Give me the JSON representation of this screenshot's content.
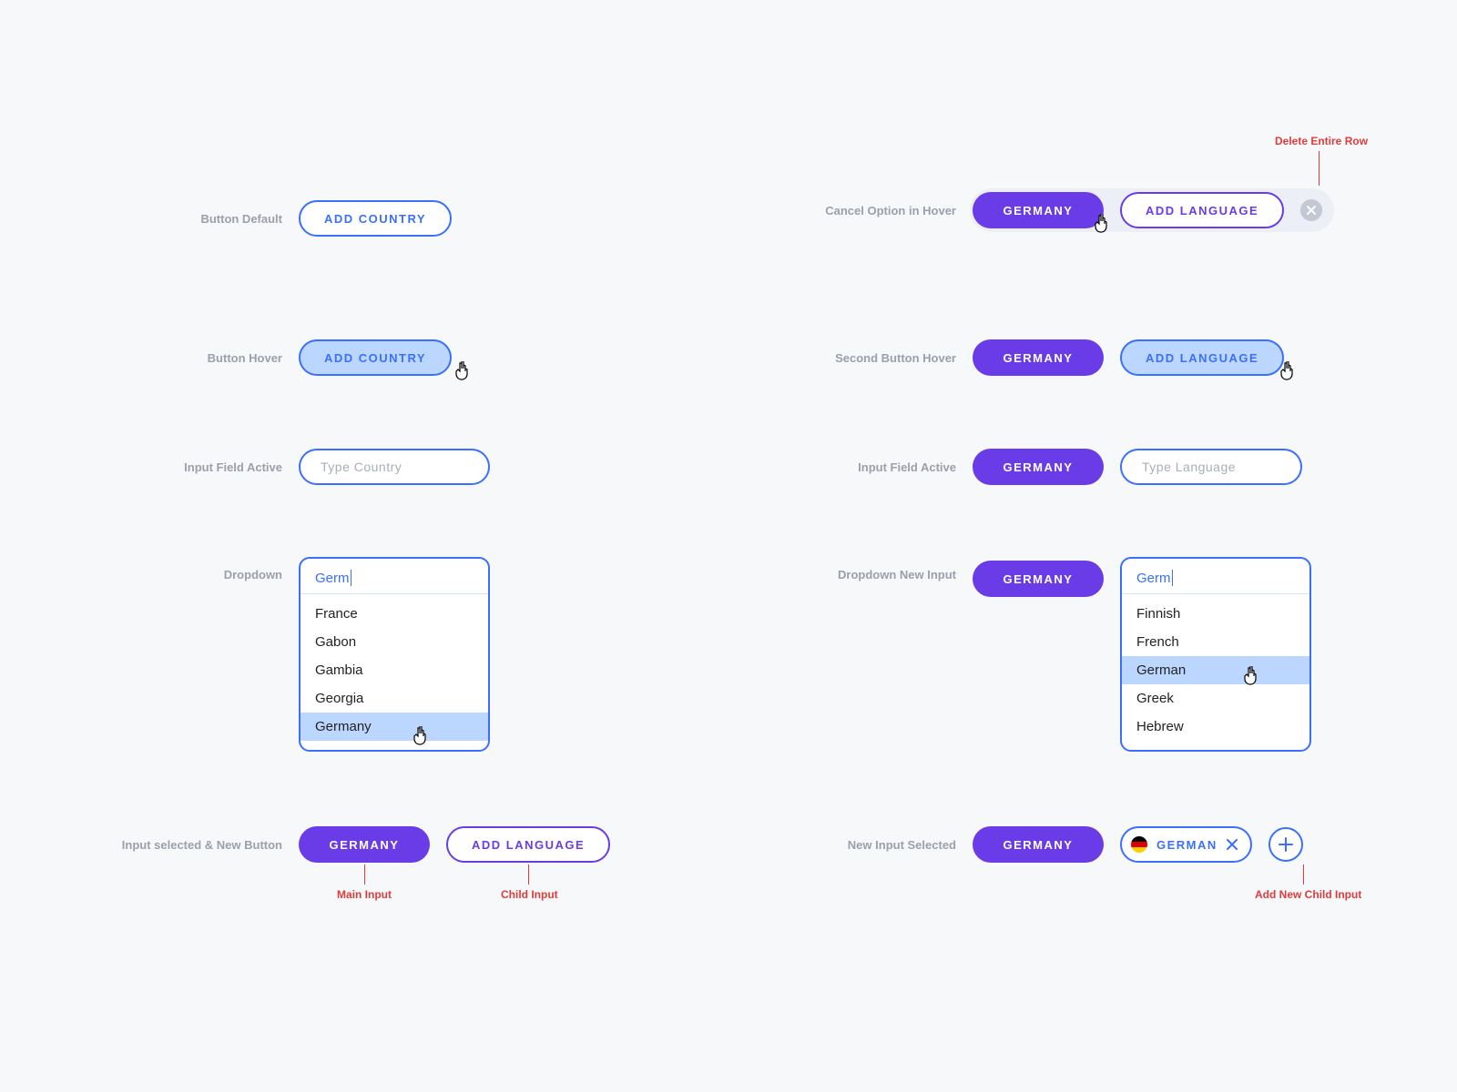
{
  "left": {
    "state1": {
      "label": "Button Default",
      "button": "ADD COUNTRY"
    },
    "state2": {
      "label": "Button Hover",
      "button": "ADD COUNTRY"
    },
    "state3": {
      "label": "Input Field Active",
      "placeholder": "Type Country"
    },
    "state4": {
      "label": "Dropdown",
      "typed": "Germ",
      "options": [
        "France",
        "Gabon",
        "Gambia",
        "Georgia",
        "Germany"
      ],
      "hovered_index": 4
    },
    "state5": {
      "label": "Input selected & New Button",
      "main": "GERMANY",
      "child_button": "ADD LANGUAGE",
      "annot_main": "Main Input",
      "annot_child": "Child Input"
    }
  },
  "right": {
    "state1": {
      "label": "Cancel Option in Hover",
      "main": "GERMANY",
      "child_button": "ADD LANGUAGE",
      "annot_delete": "Delete Entire Row"
    },
    "state2": {
      "label": "Second Button Hover",
      "main": "GERMANY",
      "child_button": "ADD LANGUAGE"
    },
    "state3": {
      "label": "Input Field Active",
      "main": "GERMANY",
      "placeholder": "Type Language"
    },
    "state4": {
      "label": "Dropdown New Input",
      "main": "GERMANY",
      "typed": "Germ",
      "options": [
        "Finnish",
        "French",
        "German",
        "Greek",
        "Hebrew"
      ],
      "hovered_index": 2
    },
    "state5": {
      "label": "New Input Selected",
      "main": "GERMANY",
      "child_selected": "GERMAN",
      "annot_add": "Add New Child Input"
    }
  }
}
